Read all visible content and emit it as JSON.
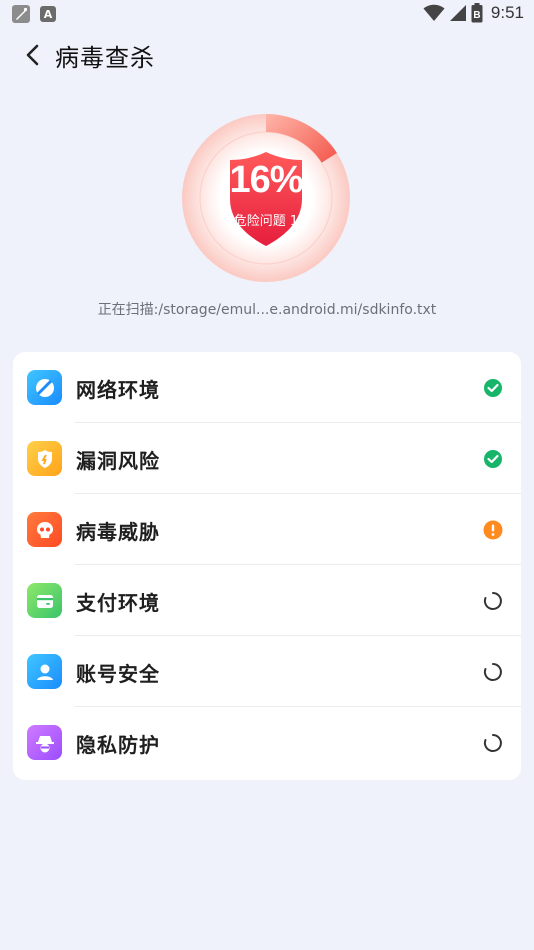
{
  "status_bar": {
    "time": "9:51",
    "notification_icons": [
      "app-icon",
      "a-letter-icon"
    ],
    "a_glyph": "A",
    "system_icons": [
      "wifi-icon",
      "signal-icon",
      "battery-icon"
    ],
    "battery_glyph": "B"
  },
  "header": {
    "title": "病毒查杀",
    "back_icon": "chevron-left-icon"
  },
  "scan": {
    "percent_label": "16%",
    "progress": 0.16,
    "issue_label": "危险问题 1",
    "scanning_text": "正在扫描:/storage/emul...e.android.mi/sdkinfo.txt"
  },
  "checks": [
    {
      "label": "网络环境",
      "icon": "network-icon",
      "status": "done",
      "status_icon": "check-circle-icon",
      "color_from": "#3fc6ff",
      "color_to": "#1a8cff"
    },
    {
      "label": "漏洞风险",
      "icon": "shield-icon",
      "status": "done",
      "status_icon": "check-circle-icon",
      "color_from": "#ffd04a",
      "color_to": "#ffa319"
    },
    {
      "label": "病毒威胁",
      "icon": "skull-icon",
      "status": "warning",
      "status_icon": "warning-circle-icon",
      "color_from": "#ff7a3d",
      "color_to": "#ff4b24"
    },
    {
      "label": "支付环境",
      "icon": "wallet-icon",
      "status": "scanning",
      "status_icon": "loading-spinner-icon",
      "color_from": "#8fe86a",
      "color_to": "#39c46b"
    },
    {
      "label": "账号安全",
      "icon": "user-icon",
      "status": "scanning",
      "status_icon": "loading-spinner-icon",
      "color_from": "#3fc6ff",
      "color_to": "#1a8cff"
    },
    {
      "label": "隐私防护",
      "icon": "incognito-icon",
      "status": "scanning",
      "status_icon": "loading-spinner-icon",
      "color_from": "#d07aff",
      "color_to": "#9b4dff"
    }
  ],
  "colors": {
    "background": "#eff2fb",
    "ok_green": "#16b56a",
    "warn_orange": "#ff8a1f",
    "danger_red": "#f23a3a"
  }
}
